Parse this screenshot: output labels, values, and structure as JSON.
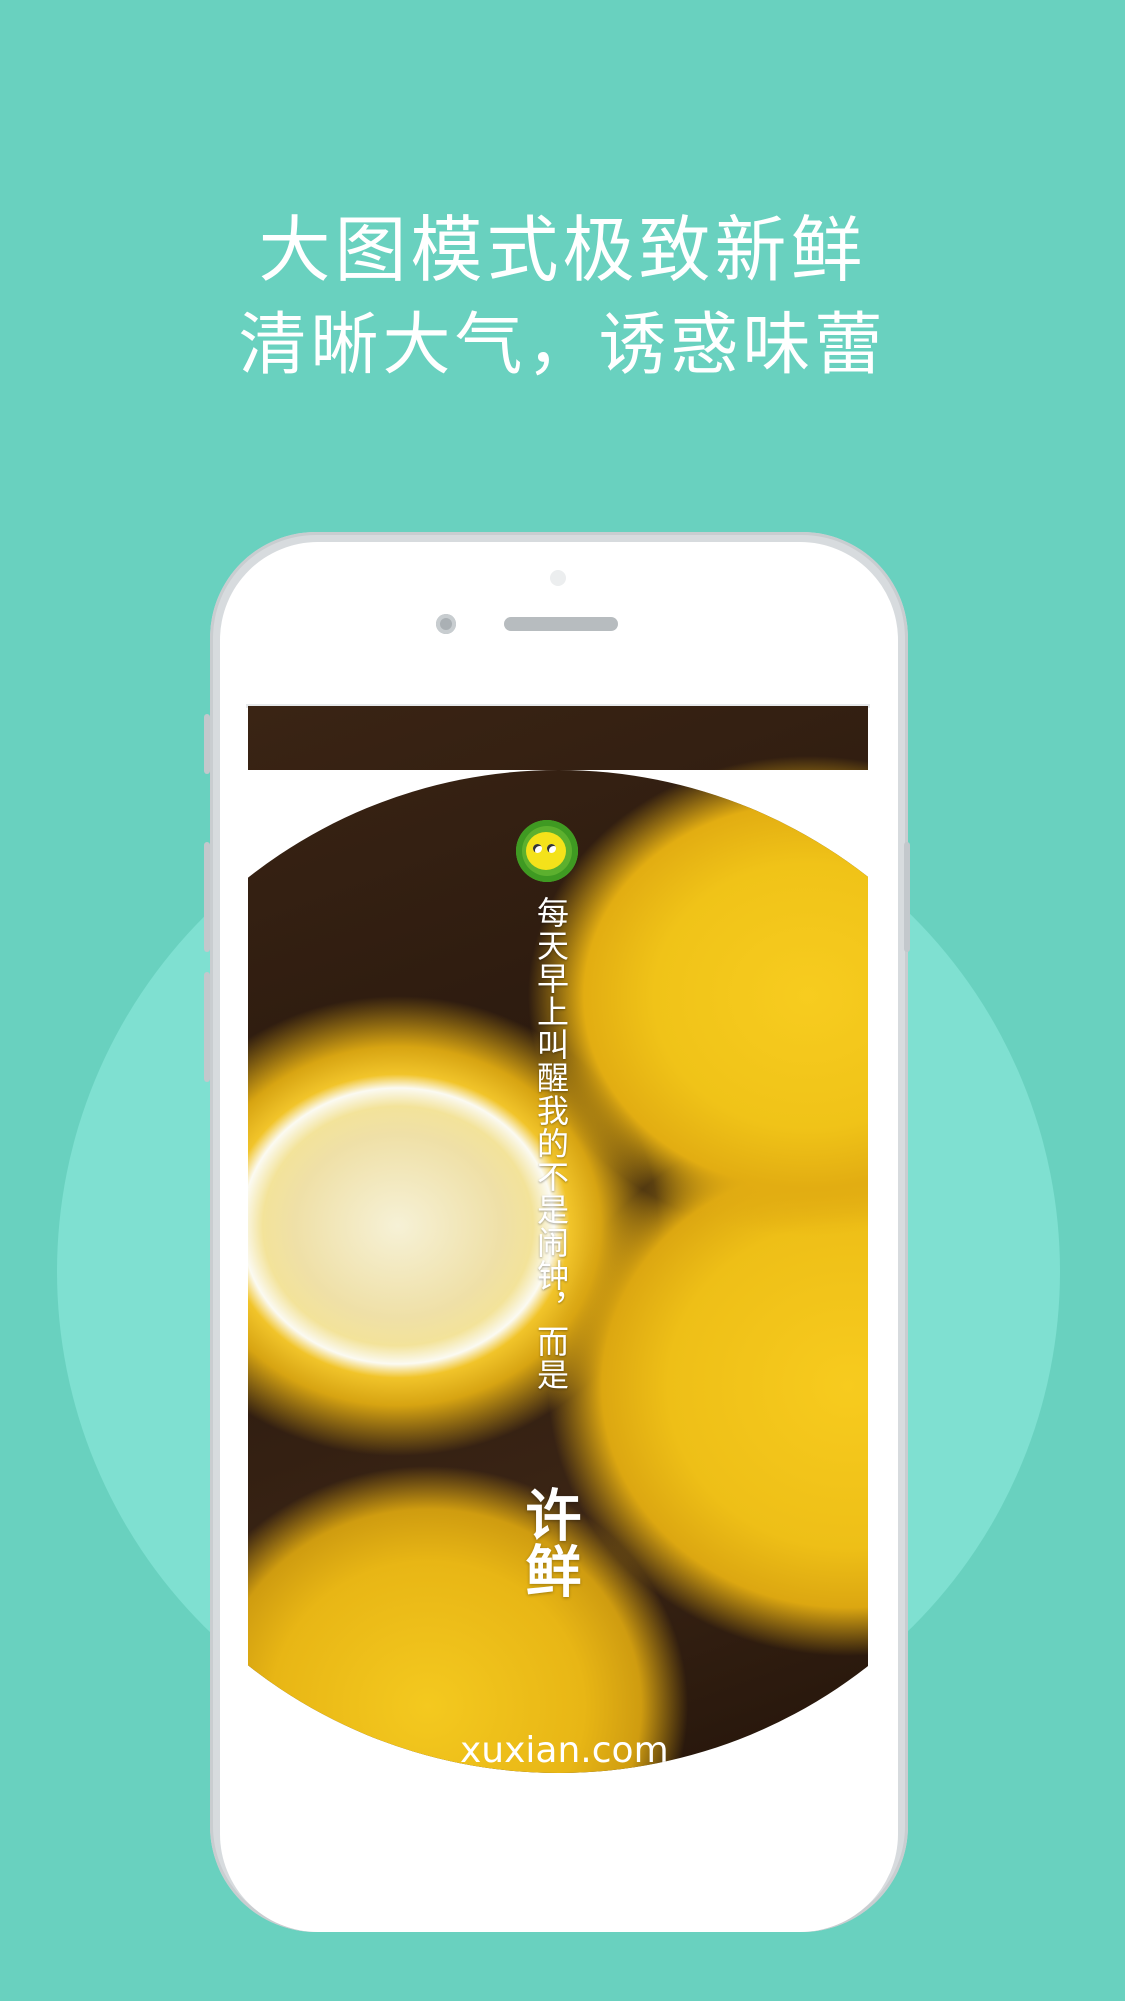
{
  "headline": {
    "line1": "大图模式极致新鲜",
    "line2": "清晰大气，诱惑味蕾"
  },
  "screen": {
    "tagline": "每天早上叫醒我的不是闹钟，而是",
    "brand": "许鲜",
    "domain": "xuxian.com",
    "logo_icon": "lemon-mascot-icon"
  },
  "colors": {
    "background": "#69d1bf",
    "circle": "#7fe0d1",
    "text": "#ffffff"
  }
}
